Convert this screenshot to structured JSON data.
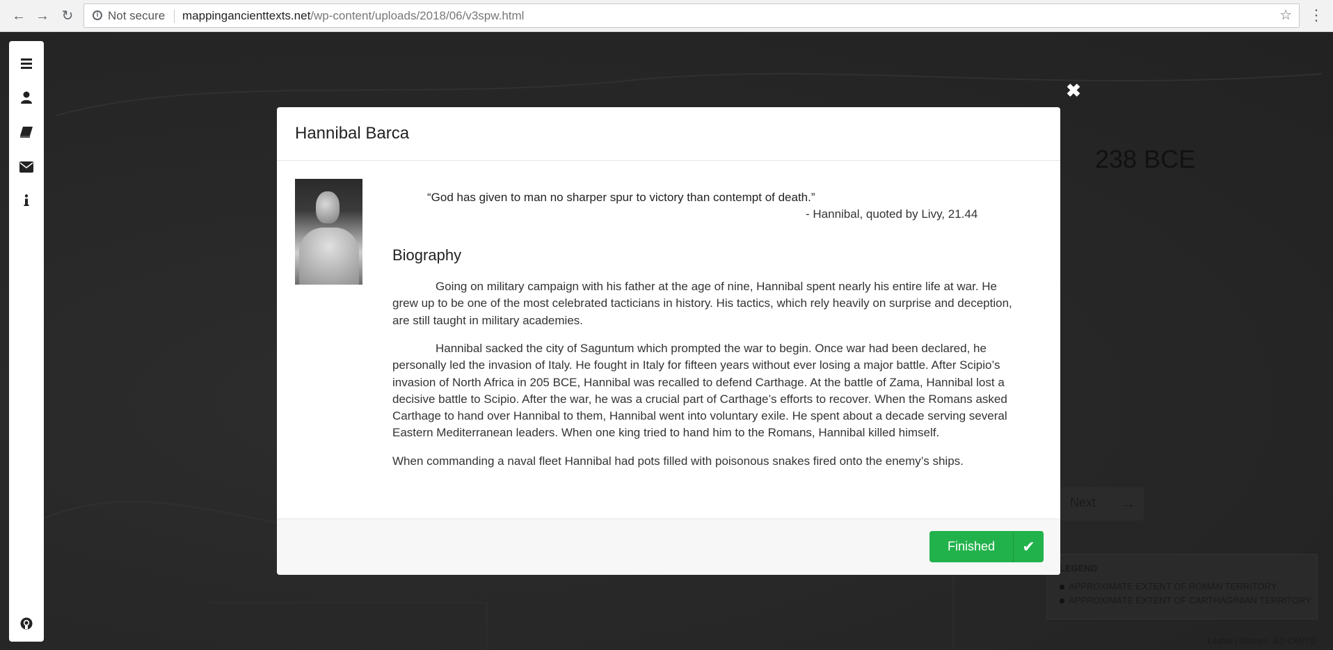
{
  "browser": {
    "security_label": "Not secure",
    "url_domain": "mappingancienttexts.net",
    "url_path": "/wp-content/uploads/2018/06/v3spw.html"
  },
  "map": {
    "year": "238 BCE",
    "next_label": "Next",
    "legend": {
      "title": "LEGEND",
      "items": [
        "APPROXIMATE EXTENT OF ROMAN TERRITORY",
        "APPROXIMATE EXTENT OF CARTHAGINIAN TERRITORY"
      ]
    },
    "attribution": "Leaflet | Stamen, Â© CARTO"
  },
  "sidebar": {
    "icons": [
      "menu-icon",
      "user-icon",
      "book-icon",
      "envelope-icon",
      "info-icon",
      "github-icon"
    ]
  },
  "modal": {
    "title": "Hannibal Barca",
    "quote": "“God has given to man no sharper spur to victory than contempt of death.”",
    "citation": "- Hannibal, quoted by Livy, 21.44",
    "bio_heading": "Biography",
    "paragraphs": [
      "Going on military campaign with his father at the age of nine, Hannibal spent nearly his entire life at war. He grew up to be one of the most celebrated tacticians in history. His tactics, which rely heavily on surprise and deception, are still taught in military academies.",
      "Hannibal sacked the city of Saguntum which prompted the war to begin. Once war had been declared, he personally led the invasion of Italy. He fought in Italy for fifteen years without ever losing a major battle. After Scipio’s invasion of North Africa in 205 BCE, Hannibal was recalled to defend Carthage. At the battle of Zama, Hannibal lost a decisive battle to Scipio. After the war, he was a crucial part of Carthage’s efforts to recover. When the Romans asked Carthage to hand over Hannibal to them, Hannibal went into voluntary exile. He spent about a decade serving several Eastern Mediterranean leaders. When one king tried to hand him to the Romans, Hannibal killed himself.",
      "When commanding a naval fleet Hannibal had pots filled with poisonous snakes fired onto the enemy’s ships."
    ],
    "finished_label": "Finished",
    "accent_color": "#22b24c"
  }
}
